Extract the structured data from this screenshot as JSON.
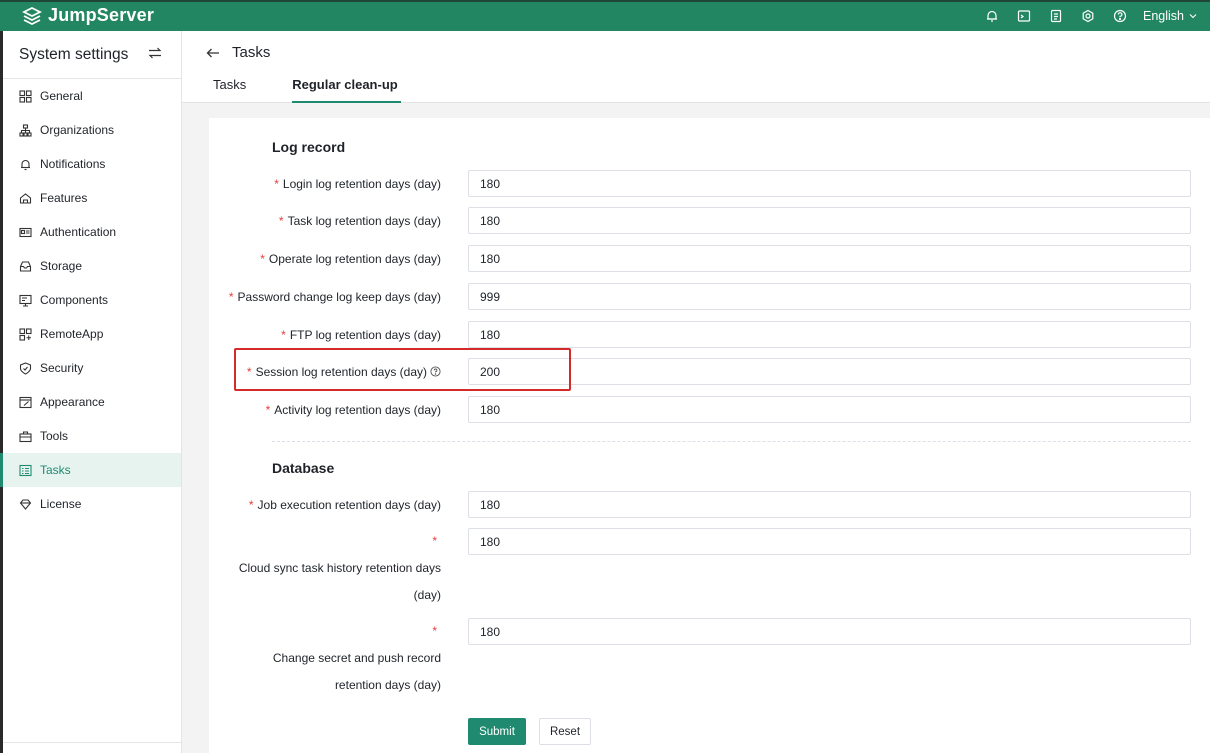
{
  "app": {
    "name": "JumpServer",
    "language": "English"
  },
  "topbar": {
    "icons": [
      "bell-icon",
      "terminal-icon",
      "clipboard-icon",
      "settings-icon",
      "help-icon"
    ]
  },
  "sidebar": {
    "title": "System settings",
    "items": [
      {
        "label": "General",
        "icon": "grid-icon"
      },
      {
        "label": "Organizations",
        "icon": "org-tree-icon"
      },
      {
        "label": "Notifications",
        "icon": "bell-icon"
      },
      {
        "label": "Features",
        "icon": "feature-icon"
      },
      {
        "label": "Authentication",
        "icon": "id-card-icon"
      },
      {
        "label": "Storage",
        "icon": "storage-icon"
      },
      {
        "label": "Components",
        "icon": "monitor-icon"
      },
      {
        "label": "RemoteApp",
        "icon": "apps-icon"
      },
      {
        "label": "Security",
        "icon": "shield-icon"
      },
      {
        "label": "Appearance",
        "icon": "appearance-icon"
      },
      {
        "label": "Tools",
        "icon": "toolbox-icon"
      },
      {
        "label": "Tasks",
        "icon": "tasks-icon",
        "active": true
      },
      {
        "label": "License",
        "icon": "license-icon"
      }
    ]
  },
  "header": {
    "title": "Tasks",
    "tabs": [
      {
        "label": "Tasks"
      },
      {
        "label": "Regular clean-up",
        "active": true
      }
    ]
  },
  "form": {
    "log_section_title": "Log record",
    "db_section_title": "Database",
    "required_mark": "*",
    "fields": {
      "login_log": {
        "label": "Login log retention days (day)",
        "value": "180"
      },
      "task_log": {
        "label": "Task log retention days (day)",
        "value": "180"
      },
      "operate_log": {
        "label": "Operate log retention days (day)",
        "value": "180"
      },
      "password_change_log": {
        "label": "Password change log keep days (day)",
        "value": "999"
      },
      "ftp_log": {
        "label": "FTP log retention days (day)",
        "value": "180"
      },
      "session_log": {
        "label": "Session log retention days (day)",
        "value": "200"
      },
      "activity_log": {
        "label": "Activity log retention days (day)",
        "value": "180"
      },
      "job_execution": {
        "label": "Job execution retention days (day)",
        "value": "180"
      },
      "cloud_sync": {
        "label_line1": "Cloud sync task history retention days",
        "label_line2": "(day)",
        "value": "180"
      },
      "change_secret": {
        "label_line1": "Change secret and push record",
        "label_line2": "retention days (day)",
        "value": "180"
      }
    },
    "submit_label": "Submit",
    "reset_label": "Reset"
  },
  "colors": {
    "brand": "#1f8a70",
    "required": "#ea3b3b",
    "highlight": "#d42a2a"
  }
}
